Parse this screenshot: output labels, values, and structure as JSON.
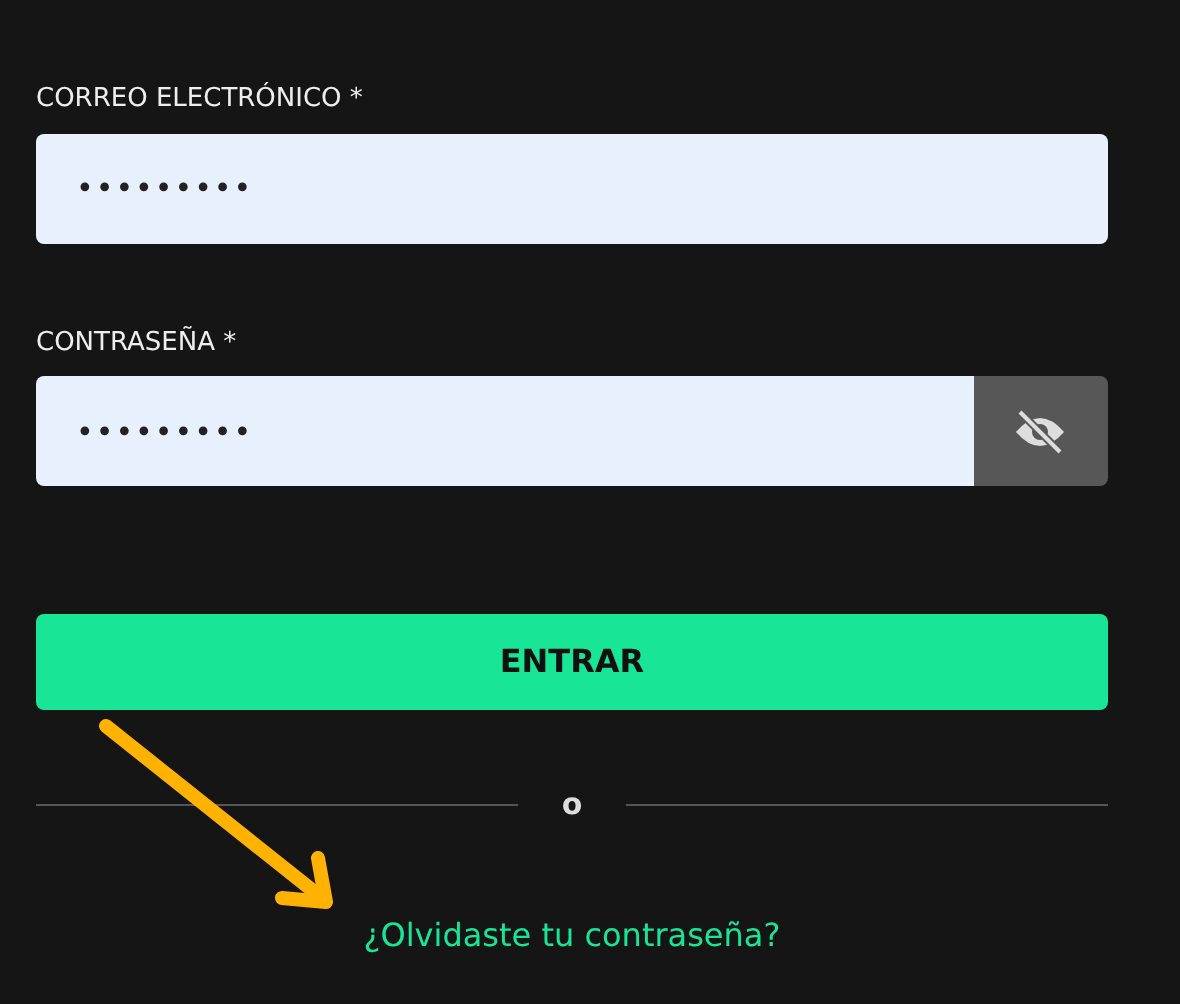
{
  "fields": [
    {
      "kind": "email",
      "label": "CORREO ELECTRÓNICO *",
      "value": "•••••••••"
    },
    {
      "kind": "password",
      "label": "CONTRASEÑA *",
      "value": "•••••••••",
      "revealed": false
    }
  ],
  "submit": "ENTRAR",
  "divider": "o",
  "forgot_link": "¿Olvidaste tu contraseña?",
  "annotation": {
    "kind": "arrow",
    "color": "#ffb300"
  }
}
